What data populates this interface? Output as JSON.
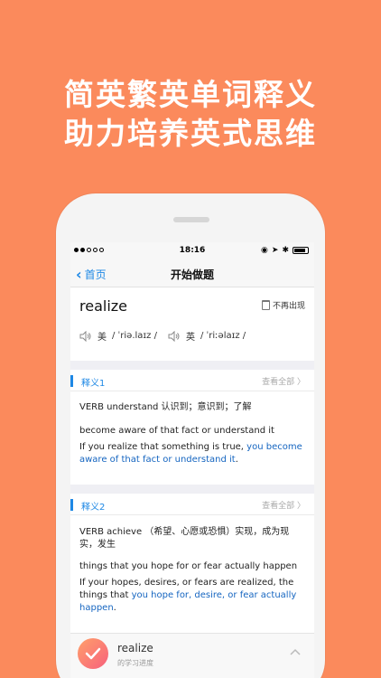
{
  "headline": {
    "line1": "简英繁英单词释义",
    "line2": "助力培养英式思维"
  },
  "status": {
    "time": "18:16"
  },
  "nav": {
    "back_label": "首页",
    "title": "开始做题"
  },
  "word_card": {
    "word": "realize",
    "hide_label": "不再出现",
    "us_label": "美",
    "us_phonetic": "/ ˈriə.laɪz /",
    "uk_label": "英",
    "uk_phonetic": "/ ˈriːəlaɪz /"
  },
  "definitions": [
    {
      "label": "释义1",
      "more": "查看全部 〉",
      "line_zh": "VERB understand 认识到；意识到；了解",
      "line_en": "become aware of that fact or understand it",
      "example_pre": "If you realize that something is true, ",
      "example_hl": "you become aware of that fact or understand it",
      "example_post": "."
    },
    {
      "label": "释义2",
      "more": "查看全部 〉",
      "line_zh": "VERB achieve （希望、心愿或恐惧）实现，成为现实，发生",
      "line_en": "things that you hope for or fear actually happen",
      "example_pre": "If your hopes, desires, or fears are realized, the things that ",
      "example_hl": "you hope for, desire, or fear actually happen",
      "example_post": "."
    }
  ],
  "bottom_bar": {
    "word": "realize",
    "subtitle": "的学习进度"
  },
  "colors": {
    "background": "#FB8A5C",
    "accent": "#1E88E5",
    "highlight": "#1565C0"
  }
}
